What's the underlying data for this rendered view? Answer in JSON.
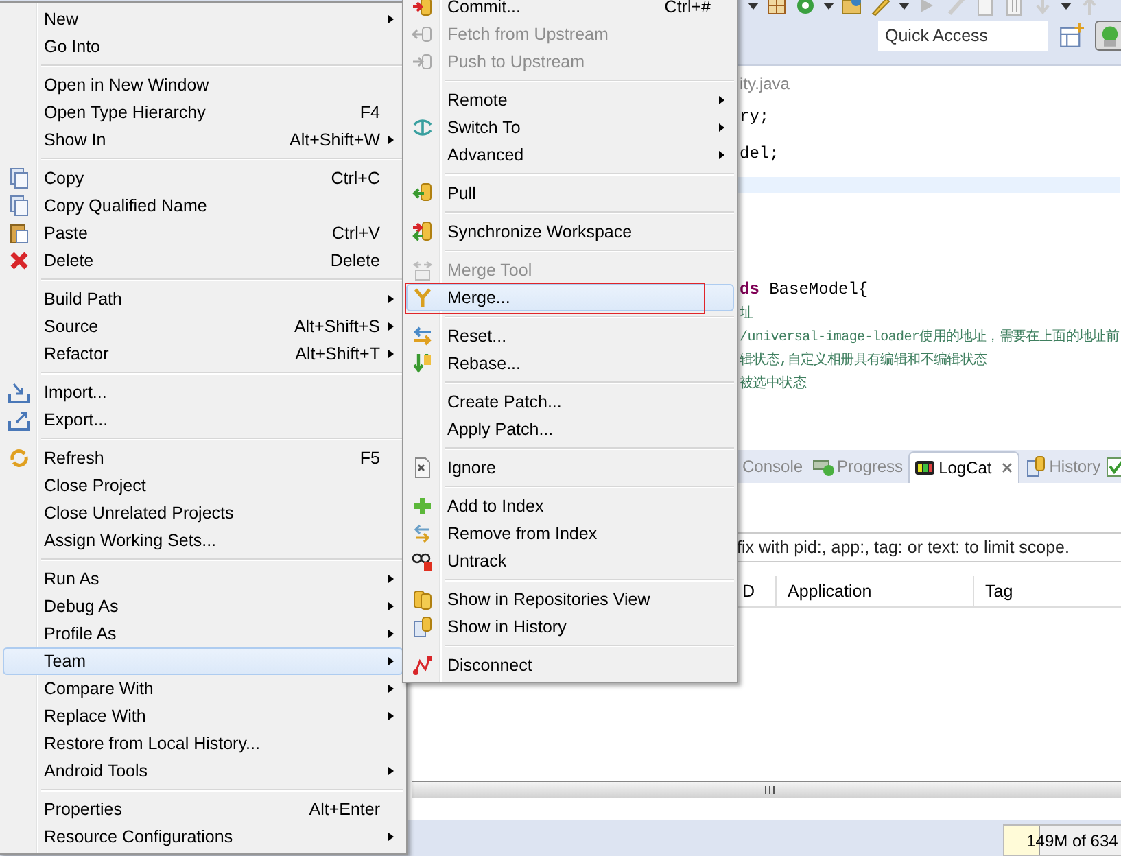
{
  "toolbar": {
    "quick_access": {
      "placeholder": "Quick Access"
    }
  },
  "editor": {
    "lines": [
      {
        "kind": "filename",
        "text": "ity.java"
      },
      {
        "kind": "code",
        "text": "ry;"
      },
      {
        "kind": "code",
        "text": "del;"
      },
      {
        "kind": "current"
      },
      {
        "kind": "declaration",
        "keyword": "ds",
        "text": " BaseModel{"
      },
      {
        "kind": "comment",
        "text": "址"
      },
      {
        "kind": "comment",
        "text": "/universal-image-loader使用的地址，需要在上面的地址前"
      },
      {
        "kind": "comment",
        "text": "辑状态,自定义相册具有编辑和不编辑状态"
      },
      {
        "kind": "comment",
        "text": "被选中状态"
      }
    ]
  },
  "panel": {
    "tabs": [
      {
        "label": "Console",
        "selected": false
      },
      {
        "label": "Progress",
        "selected": false
      },
      {
        "label": "LogCat",
        "selected": true
      },
      {
        "label": "History",
        "selected": false
      }
    ],
    "filter": {
      "placeholder": "fix with pid:, app:, tag: or text: to limit scope."
    },
    "table": {
      "columns": [
        "D",
        "Application",
        "Tag"
      ]
    }
  },
  "status_bar": {
    "heap": {
      "text": "149M of 634",
      "level": 0.28
    }
  },
  "context_menu": {
    "sections": [
      [
        {
          "label": "New",
          "submenu": true,
          "selected": false
        },
        {
          "label": "Go Into",
          "submenu": false,
          "selected": false
        }
      ],
      [
        {
          "label": "Open in New Window",
          "submenu": false,
          "selected": false
        },
        {
          "label": "Open Type Hierarchy",
          "shortcut": "F4",
          "submenu": false,
          "selected": false
        },
        {
          "label": "Show In",
          "shortcut": "Alt+Shift+W",
          "submenu": true,
          "selected": false
        }
      ],
      [
        {
          "label": "Copy",
          "shortcut": "Ctrl+C",
          "submenu": false,
          "selected": false
        },
        {
          "label": "Copy Qualified Name",
          "submenu": false,
          "selected": false
        },
        {
          "label": "Paste",
          "shortcut": "Ctrl+V",
          "submenu": false,
          "selected": false
        },
        {
          "label": "Delete",
          "shortcut": "Delete",
          "submenu": false,
          "selected": false
        }
      ],
      [
        {
          "label": "Build Path",
          "submenu": true,
          "selected": false
        },
        {
          "label": "Source",
          "shortcut": "Alt+Shift+S",
          "submenu": true,
          "selected": false
        },
        {
          "label": "Refactor",
          "shortcut": "Alt+Shift+T",
          "submenu": true,
          "selected": false
        }
      ],
      [
        {
          "label": "Import...",
          "submenu": false,
          "selected": false
        },
        {
          "label": "Export...",
          "submenu": false,
          "selected": false
        }
      ],
      [
        {
          "label": "Refresh",
          "shortcut": "F5",
          "submenu": false,
          "selected": false
        },
        {
          "label": "Close Project",
          "submenu": false,
          "selected": false
        },
        {
          "label": "Close Unrelated Projects",
          "submenu": false,
          "selected": false
        },
        {
          "label": "Assign Working Sets...",
          "submenu": false,
          "selected": false
        }
      ],
      [
        {
          "label": "Run As",
          "submenu": true,
          "selected": false
        },
        {
          "label": "Debug As",
          "submenu": true,
          "selected": false
        },
        {
          "label": "Profile As",
          "submenu": true,
          "selected": false
        },
        {
          "label": "Team",
          "submenu": true,
          "selected": true
        },
        {
          "label": "Compare With",
          "submenu": true,
          "selected": false
        },
        {
          "label": "Replace With",
          "submenu": true,
          "selected": false
        },
        {
          "label": "Restore from Local History...",
          "submenu": false,
          "selected": false
        },
        {
          "label": "Android Tools",
          "submenu": true,
          "selected": false
        }
      ],
      [
        {
          "label": "Properties",
          "shortcut": "Alt+Enter",
          "submenu": false,
          "selected": false
        },
        {
          "label": "Resource Configurations",
          "submenu": true,
          "selected": false
        }
      ]
    ]
  },
  "team_submenu": {
    "sections": [
      [
        {
          "label": "Commit...",
          "shortcut": "Ctrl+#",
          "submenu": false,
          "disabled": false,
          "highlighted": false
        },
        {
          "label": "Fetch from Upstream",
          "submenu": false,
          "disabled": true,
          "highlighted": false
        },
        {
          "label": "Push to Upstream",
          "submenu": false,
          "disabled": true,
          "highlighted": false
        }
      ],
      [
        {
          "label": "Remote",
          "submenu": true,
          "disabled": false,
          "highlighted": false
        },
        {
          "label": "Switch To",
          "submenu": true,
          "disabled": false,
          "highlighted": false
        },
        {
          "label": "Advanced",
          "submenu": true,
          "disabled": false,
          "highlighted": false
        }
      ],
      [
        {
          "label": "Pull",
          "submenu": false,
          "disabled": false,
          "highlighted": false
        }
      ],
      [
        {
          "label": "Synchronize Workspace",
          "submenu": false,
          "disabled": false,
          "highlighted": false
        }
      ],
      [
        {
          "label": "Merge Tool",
          "submenu": false,
          "disabled": true,
          "highlighted": false
        },
        {
          "label": "Merge...",
          "submenu": false,
          "disabled": false,
          "highlighted": true
        }
      ],
      [
        {
          "label": "Reset...",
          "submenu": false,
          "disabled": false,
          "highlighted": false
        },
        {
          "label": "Rebase...",
          "submenu": false,
          "disabled": false,
          "highlighted": false
        }
      ],
      [
        {
          "label": "Create Patch...",
          "submenu": false,
          "disabled": false,
          "highlighted": false
        },
        {
          "label": "Apply Patch...",
          "submenu": false,
          "disabled": false,
          "highlighted": false
        }
      ],
      [
        {
          "label": "Ignore",
          "submenu": false,
          "disabled": false,
          "highlighted": false
        }
      ],
      [
        {
          "label": "Add to Index",
          "submenu": false,
          "disabled": false,
          "highlighted": false
        },
        {
          "label": "Remove from Index",
          "submenu": false,
          "disabled": false,
          "highlighted": false
        },
        {
          "label": "Untrack",
          "submenu": false,
          "disabled": false,
          "highlighted": false
        }
      ],
      [
        {
          "label": "Show in Repositories View",
          "submenu": false,
          "disabled": false,
          "highlighted": false
        },
        {
          "label": "Show in History",
          "submenu": false,
          "disabled": false,
          "highlighted": false
        }
      ],
      [
        {
          "label": "Disconnect",
          "submenu": false,
          "disabled": false,
          "highlighted": false
        }
      ]
    ]
  }
}
